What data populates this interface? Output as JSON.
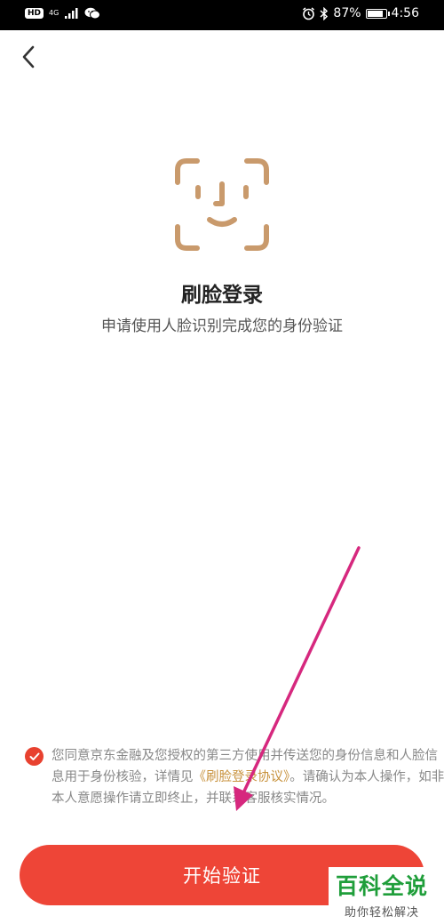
{
  "status_bar": {
    "hd_badge": "HD",
    "network_type": "4G",
    "battery_percent": "87%",
    "battery_level": 0.87,
    "time": "4:56",
    "icons": [
      "hd-icon",
      "signal-icon",
      "wechat-icon",
      "alarm-icon",
      "bluetooth-icon",
      "battery-icon"
    ]
  },
  "header": {
    "back_icon": "chevron-left-icon"
  },
  "main": {
    "face_icon": "face-id-icon",
    "title": "刷脸登录",
    "subtitle": "申请使用人脸识别完成您的身份验证"
  },
  "agreement": {
    "checked": true,
    "text_before": "您同意京东金融及您授权的第三方使用并传送您的身份信息和人脸信息用于身份核验，详情见",
    "link_text": "《刷脸登录协议》",
    "text_after": "。请确认为本人操作，如非本人意愿操作请立即终止，并联系客服核实情况。"
  },
  "actions": {
    "start_label": "开始验证"
  },
  "watermark": {
    "main": "百科全说",
    "sub": "助你轻松解决"
  },
  "colors": {
    "accent": "#ee4537",
    "check": "#e8412f",
    "link": "#c8923d",
    "face_icon": "#c99a6c",
    "annotation_arrow": "#d6287e",
    "watermark_green": "#1f9e3a"
  }
}
